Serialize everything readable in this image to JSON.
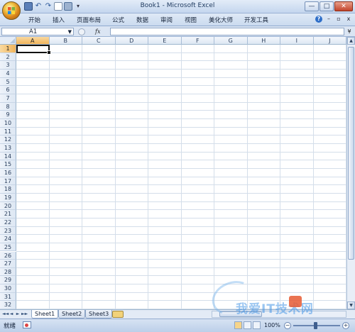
{
  "window": {
    "title": "Book1 - Microsoft Excel",
    "min_label": "—",
    "max_label": "□",
    "close_label": "✕"
  },
  "ribbon_tabs": [
    "开始",
    "插入",
    "页面布局",
    "公式",
    "数据",
    "审阅",
    "视图",
    "美化大师",
    "开发工具"
  ],
  "ribbon_right": {
    "help": "?",
    "min": "–",
    "restore": "▫",
    "close": "x"
  },
  "formula_bar": {
    "name_box": "A1",
    "fx_label": "fx",
    "formula_value": "",
    "expand_label": "¥"
  },
  "columns": [
    "A",
    "B",
    "C",
    "D",
    "E",
    "F",
    "G",
    "H",
    "I",
    "J"
  ],
  "rows": [
    "1",
    "2",
    "3",
    "4",
    "5",
    "6",
    "7",
    "8",
    "9",
    "10",
    "11",
    "12",
    "13",
    "14",
    "15",
    "16",
    "17",
    "18",
    "19",
    "20",
    "21",
    "22",
    "23",
    "24",
    "25",
    "26",
    "27",
    "28",
    "29",
    "30",
    "31",
    "32"
  ],
  "selected_cell": "A1",
  "sheets": [
    "Sheet1",
    "Sheet2",
    "Sheet3"
  ],
  "active_sheet": "Sheet1",
  "sheet_nav": [
    "◄◄",
    "◄",
    "►",
    "►►"
  ],
  "status": {
    "ready_text": "就绪",
    "zoom": "100%",
    "zoom_minus": "−",
    "zoom_plus": "+"
  },
  "watermark": {
    "text": "我爱IT技术网"
  },
  "colors": {
    "accent": "#f1b45a",
    "titlebar": "#c4d6ee",
    "grid_line": "#d4deea"
  }
}
